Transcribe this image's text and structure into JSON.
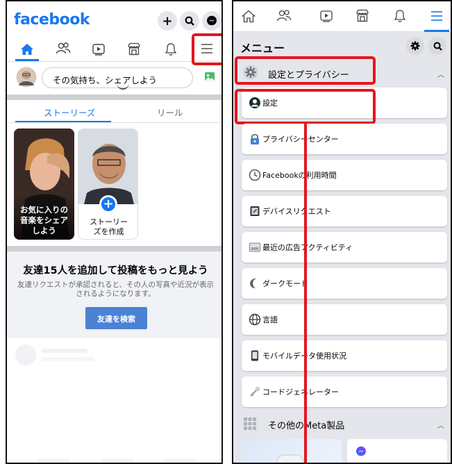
{
  "left": {
    "logo": "facebook",
    "composer_placeholder": "その気持ち、シェアしよう",
    "tabs": [
      "ストーリーズ",
      "リール"
    ],
    "story_cards": [
      {
        "text": "お気に入りの\n音楽をシェア\nしよう"
      },
      {
        "text": "ストーリー\nズを作成"
      }
    ],
    "suggest_title": "友達15人を追加して投稿をもっと見よう",
    "suggest_sub": "友達リクエストが承認されると、その人の写真や近況が表示されるようになります。",
    "find_friends_button": "友達を検索"
  },
  "right": {
    "menu_title": "メニュー",
    "section_settings": "設定とプライバシー",
    "items": [
      {
        "label": "設定",
        "icon": "user-circle-icon"
      },
      {
        "label": "プライバシーセンター",
        "icon": "privacy-lock-icon"
      },
      {
        "label": "Facebookの利用時間",
        "icon": "clock-icon"
      },
      {
        "label": "デバイスリクエスト",
        "icon": "device-icon"
      },
      {
        "label": "最近の広告アクティビティ",
        "icon": "ad-icon"
      },
      {
        "label": "ダークモード",
        "icon": "moon-icon"
      },
      {
        "label": "言語",
        "icon": "globe-icon"
      },
      {
        "label": "モバイルデータ使用状況",
        "icon": "phone-icon"
      },
      {
        "label": "コードジェネレーター",
        "icon": "key-icon"
      }
    ],
    "section_meta": "その他のMeta製品"
  },
  "colors": {
    "brand": "#1877f2",
    "highlight": "#e4161f"
  }
}
